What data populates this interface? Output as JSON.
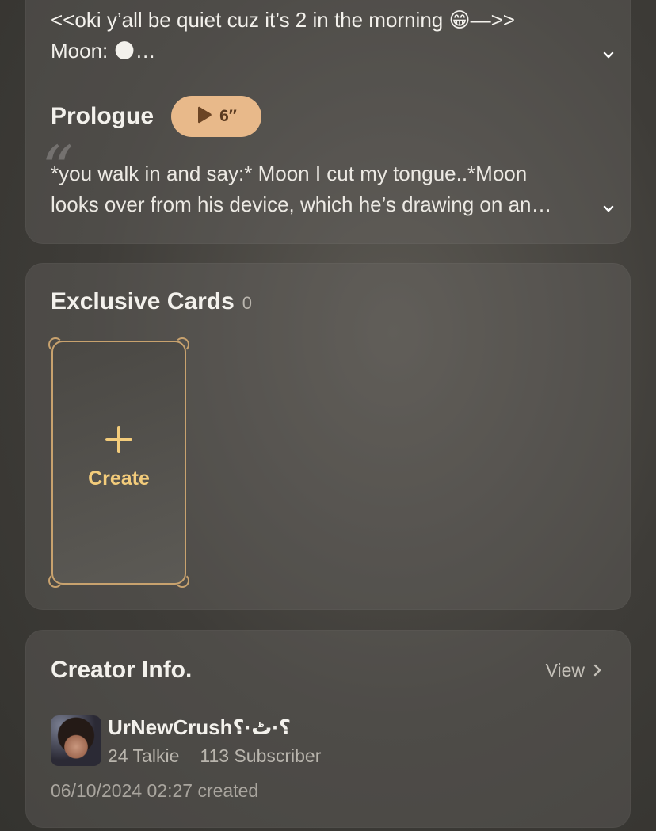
{
  "intro": {
    "text_line1": "<<oki y’all be quiet cuz it’s 2 in the morning 😁—>>",
    "text_line2": "Moon: 🌑…"
  },
  "prologue": {
    "title": "Prologue",
    "audio_duration": "6″",
    "text_line1": "*you walk in and say:* Moon I cut my tongue..*Moon",
    "text_line2": "looks over from his device, which he’s drawing on an…"
  },
  "exclusive_cards": {
    "title": "Exclusive Cards",
    "count": "0",
    "create_label": "Create"
  },
  "creator_info": {
    "title": "Creator Info.",
    "view_label": "View",
    "name": "UrNewCrush؟·ٹ·؟",
    "talkie_count": "24 Talkie",
    "subscriber_count": "113 Subscriber",
    "created": "06/10/2024 02:27 created"
  },
  "icons": {
    "intro_expand": "chevron-down-icon",
    "prologue_expand": "chevron-down-icon",
    "audio": "play-wave-icon",
    "create": "plus-icon",
    "view": "chevron-right-icon"
  },
  "colors": {
    "accent_gold": "#f3cc7b",
    "pill_bg": "#e8b98a",
    "card_border": "#c8a26e"
  }
}
